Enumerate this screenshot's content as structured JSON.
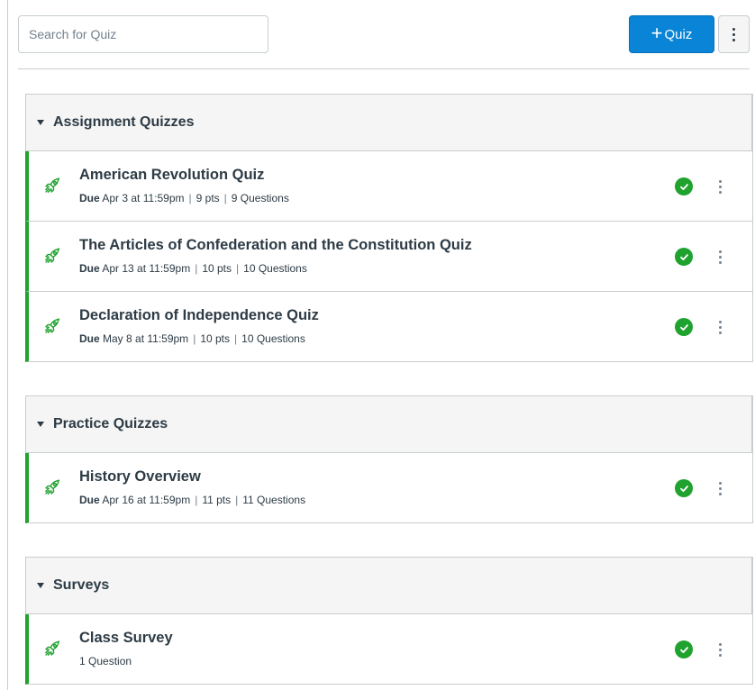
{
  "toolbar": {
    "search_placeholder": "Search for Quiz",
    "add_quiz_label": "Quiz",
    "add_quiz_icon": "plus-icon",
    "more_icon": "kebab-menu-icon",
    "accent_color": "#0a84d6"
  },
  "colors": {
    "published_green": "#1fa22e",
    "header_bg": "#f5f5f5",
    "border": "#c7cdd1",
    "text": "#2d3b45"
  },
  "groups": [
    {
      "title": "Assignment Quizzes",
      "items": [
        {
          "title": "American Revolution Quiz",
          "due_label": "Due",
          "due_date": "Apr 3 at 11:59pm",
          "points": "9 pts",
          "questions": "9 Questions",
          "status": "published",
          "icon": "rocket-icon"
        },
        {
          "title": "The Articles of Confederation and the Constitution Quiz",
          "due_label": "Due",
          "due_date": "Apr 13 at 11:59pm",
          "points": "10 pts",
          "questions": "10 Questions",
          "status": "published",
          "icon": "rocket-icon"
        },
        {
          "title": "Declaration of Independence Quiz",
          "due_label": "Due",
          "due_date": "May 8 at 11:59pm",
          "points": "10 pts",
          "questions": "10 Questions",
          "status": "published",
          "icon": "rocket-icon"
        }
      ]
    },
    {
      "title": "Practice Quizzes",
      "items": [
        {
          "title": "History Overview",
          "due_label": "Due",
          "due_date": "Apr 16 at 11:59pm",
          "points": "11 pts",
          "questions": "11 Questions",
          "status": "published",
          "icon": "rocket-icon"
        }
      ]
    },
    {
      "title": "Surveys",
      "items": [
        {
          "title": "Class Survey",
          "questions": "1 Question",
          "status": "published",
          "icon": "rocket-icon"
        }
      ]
    }
  ]
}
